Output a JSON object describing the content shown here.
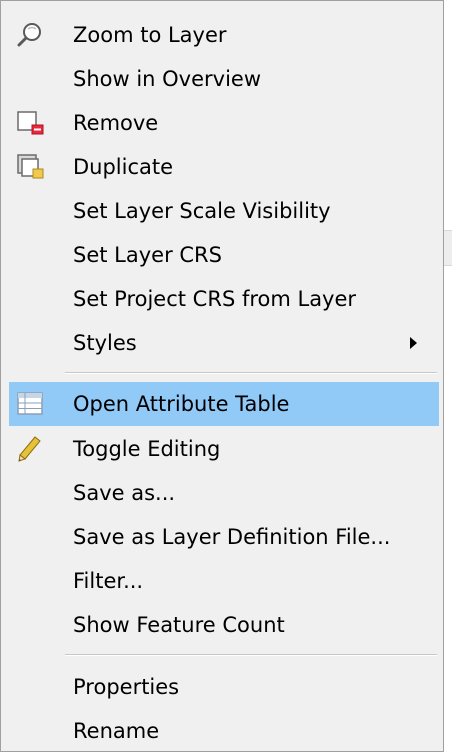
{
  "menu": {
    "items": [
      {
        "label": "Zoom to Layer",
        "icon": "zoom-magnifier-icon"
      },
      {
        "label": "Show in Overview",
        "icon": ""
      },
      {
        "label": "Remove",
        "icon": "remove-layer-icon"
      },
      {
        "label": "Duplicate",
        "icon": "duplicate-layer-icon"
      },
      {
        "label": "Set Layer Scale Visibility",
        "icon": ""
      },
      {
        "label": "Set Layer CRS",
        "icon": ""
      },
      {
        "label": "Set Project CRS from Layer",
        "icon": ""
      },
      {
        "label": "Styles",
        "icon": "",
        "submenu": true
      },
      {
        "label": "Open Attribute Table",
        "icon": "attribute-table-icon",
        "highlighted": true
      },
      {
        "label": "Toggle Editing",
        "icon": "pencil-icon"
      },
      {
        "label": "Save as...",
        "icon": ""
      },
      {
        "label": "Save as Layer Definition File...",
        "icon": ""
      },
      {
        "label": "Filter...",
        "icon": ""
      },
      {
        "label": "Show Feature Count",
        "icon": ""
      },
      {
        "label": "Properties",
        "icon": ""
      },
      {
        "label": "Rename",
        "icon": ""
      }
    ]
  },
  "colors": {
    "menu_background": "#f0f0f0",
    "highlight": "#91c9f7",
    "remove_badge": "#e8283c",
    "duplicate_badge": "#f2c94c",
    "pencil": "#e6c23a"
  }
}
